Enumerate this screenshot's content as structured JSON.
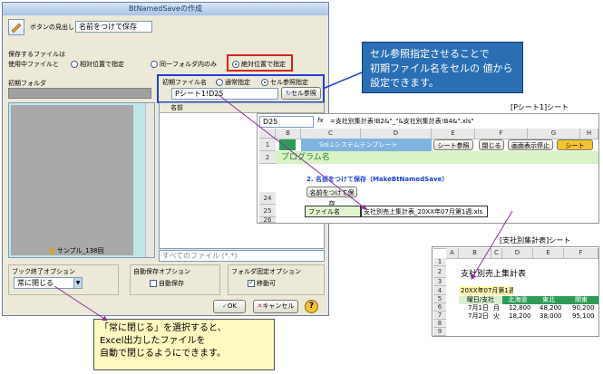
{
  "dialog": {
    "title": "BtNamedSaveの作成",
    "button_label_caption": "ボタンの見出し",
    "button_label_value": "名前をつけて保存",
    "save_target_group": "保存するファイルは",
    "options": [
      "使用中ファイルと",
      "相対位置で指定",
      "同一フォルダ内のみ",
      "絶対位置で指定"
    ],
    "initial_folder_label": "初期フォルダ",
    "initial_file_label": "初期ファイル名",
    "file_mode_options": [
      "通常指定",
      "セル参照指定"
    ],
    "cell_ref_value": "Pシート1!D25",
    "cell_ref_button": "セル参照",
    "name_column": "名前",
    "folder_item": "サンプル_138回",
    "file_type_filter": "すべてのファイル (*.*)",
    "close_option_group": "ブック終了オプション",
    "close_option_value": "常に閉じる",
    "autosave_group": "自動保存オプション",
    "autosave_label": "自動保存",
    "folder_fixed_group": "フォルダ固定オプション",
    "folder_fixed_label": "移動可",
    "ok_label": "OK",
    "cancel_label": "キャンセル",
    "help_label": "?"
  },
  "callout_cell": {
    "line1": "セル参照指定させることで",
    "line2": "初期ファイル名をセルの 値から",
    "line3": "設定できます。"
  },
  "callout_close": {
    "line1": "「常に閉じる」を選択すると、",
    "line2": "Excel出力したファイルを",
    "line3": "自動で閉じるようにできます。"
  },
  "sheet1": {
    "caption": "[Pシート1]シート",
    "cell_ref": "D25",
    "formula": "=支社別集計表!B2&\"_\"&支社別集計表!B4&\".xls\"",
    "columns": [
      "B",
      "C",
      "D",
      "E",
      "F",
      "G",
      "H"
    ],
    "rows": [
      "1",
      "2",
      "24",
      "25",
      "26"
    ],
    "banner": "Sol.Lシステムテンプレート",
    "program_name": "プログラム名",
    "buttons": [
      "シート参照",
      "閉じる",
      "画面表示停止",
      "シート"
    ],
    "section_title": "2. 名前をつけて保存（MakeBtNamedSave）",
    "save_button": "名前をつけて保存",
    "file_label": "ファイル名",
    "file_value": "支社別売上集計表_20XX年07月第1週.xls"
  },
  "sheet2": {
    "caption": "[支社別集計表]シート",
    "columns": [
      "A",
      "B",
      "C",
      "D",
      "E",
      "F"
    ],
    "rows": [
      "1",
      "2",
      "3",
      "4",
      "5",
      "6",
      "7",
      "8",
      "9"
    ],
    "title": "支社別売上集計表",
    "period": "20XX年07月第1週",
    "headers": [
      "曜日/支社",
      "北海道",
      "東北",
      "関東"
    ],
    "data": [
      [
        "7月1日",
        "月",
        "12,800",
        "48,200",
        "90,200"
      ],
      [
        "7月2日",
        "火",
        "18,200",
        "38,000",
        "95,100"
      ]
    ]
  },
  "colors": {
    "callout_blue": "#2a6fb4",
    "callout_yellow": "#fff9c2",
    "highlight_red": "#d4251c",
    "arrow_purple": "#8e2fa0",
    "sheet_green": "#2e9b56"
  }
}
